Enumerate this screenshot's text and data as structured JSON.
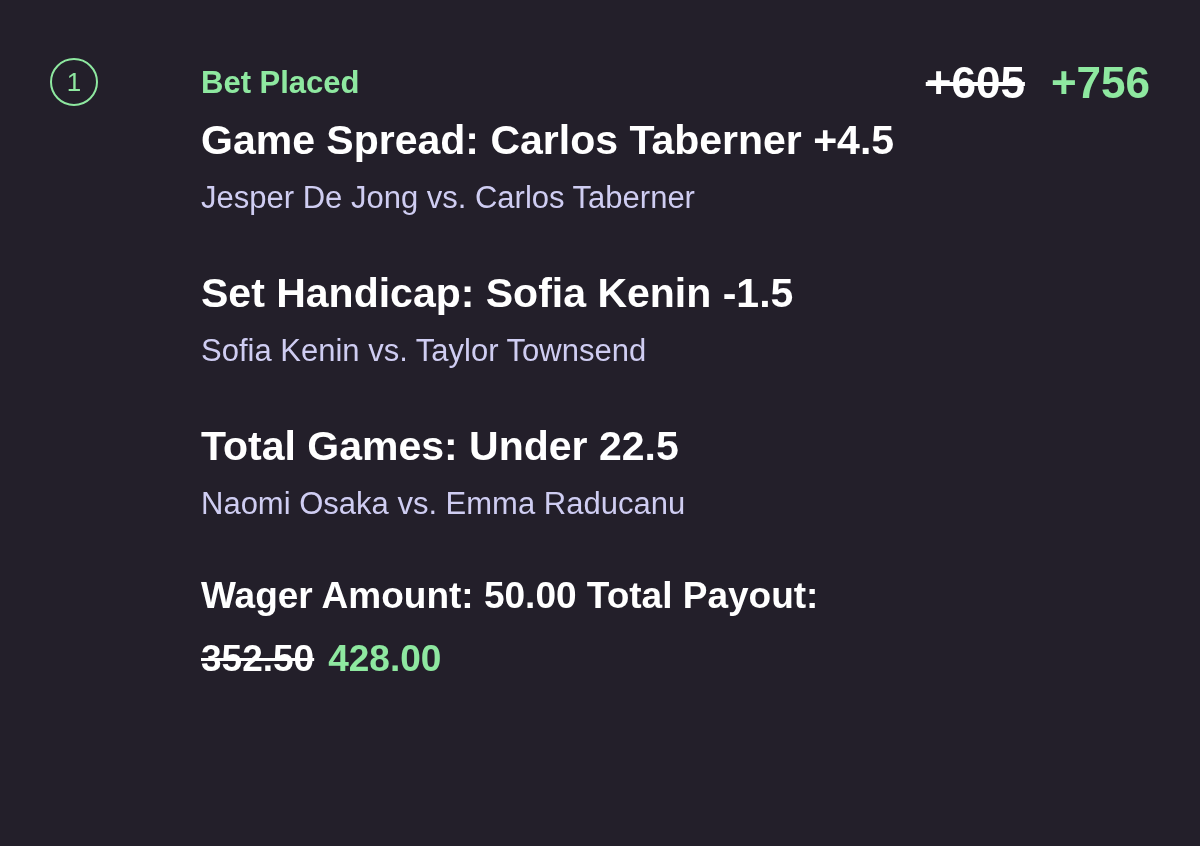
{
  "step_number": "1",
  "status": "Bet Placed",
  "odds": {
    "original": "+605",
    "boosted": "+756"
  },
  "legs": [
    {
      "market": "Game Spread: Carlos Taberner +4.5",
      "match": "Jesper De Jong vs. Carlos Taberner"
    },
    {
      "market": "Set Handicap: Sofia Kenin -1.5",
      "match": "Sofia Kenin vs. Taylor Townsend"
    },
    {
      "market": "Total Games: Under 22.5",
      "match": "Naomi Osaka vs. Emma Raducanu"
    }
  ],
  "wager_line": "Wager Amount: 50.00 Total Payout:",
  "payout": {
    "original": "352.50",
    "boosted": "428.00"
  }
}
